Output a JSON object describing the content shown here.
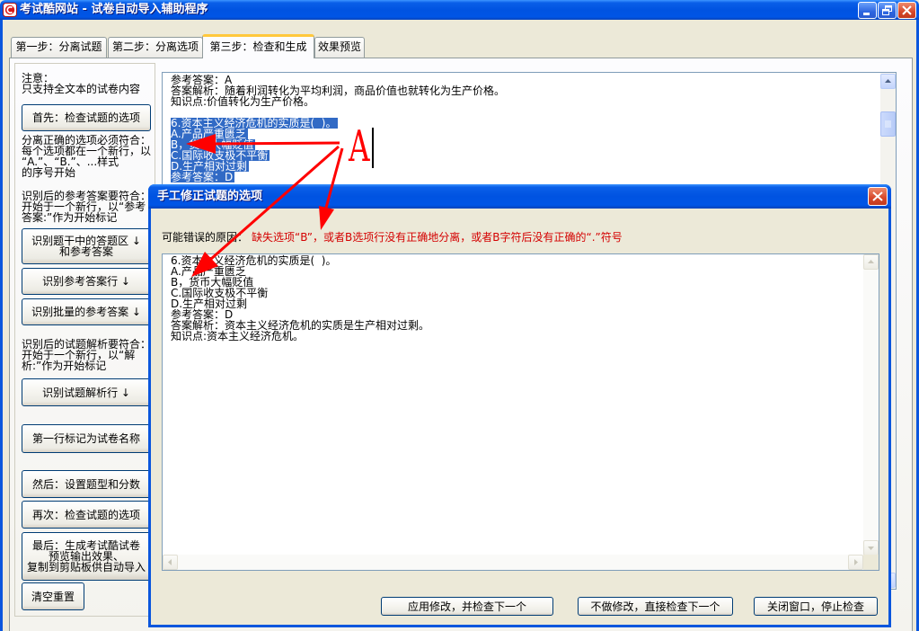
{
  "window": {
    "title": "考试酷网站 - 试卷自动导入辅助程序",
    "icons": {
      "app": "app-logo-icon",
      "minimize": "minimize-icon",
      "restore": "restore-icon",
      "close": "close-icon"
    }
  },
  "tabs": [
    {
      "label": "第一步：分离试题",
      "active": false
    },
    {
      "label": "第二步：分离选项",
      "active": false
    },
    {
      "label": "第三步：检查和生成",
      "active": true
    },
    {
      "label": "效果预览",
      "active": false
    }
  ],
  "sidebar": {
    "note": "注意：\n只支持全文本的试卷内容",
    "check_options_button": "首先：检查试题的选项",
    "option_rule": "分离正确的选项必须符合：\n每个选项都在一个新行，以\n“A.”、“B.”、...样式\n的序号开始",
    "answer_rule": "识别后的参考答案要符合：\n开始于一个新行，以“参考\n答案:”作为开始标记",
    "answer_area_button": "识别题干中的答题区 ↓\n和参考答案",
    "answer_line_button": "识别参考答案行 ↓",
    "batch_answer_button": "识别批量的参考答案 ↓",
    "analysis_rule": "识别后的试题解析要符合：\n开始于一个新行，以“解\n析:”作为开始标记",
    "analysis_line_button": "识别试题解析行 ↓",
    "paper_title_button": "第一行标记为试卷名称",
    "set_types_button": "然后：设置题型和分数",
    "recheck_button": "再次：检查试题的选项",
    "generate_button": "最后：生成考试酷试卷\n预览输出效果、\n复制到剪贴板供自动导入",
    "reset_button": "清空重置"
  },
  "editor": {
    "lines": [
      {
        "text": "参考答案：A",
        "selected": false
      },
      {
        "text": "答案解析：随着利润转化为平均利润，商品价值也就转化为生产价格。",
        "selected": false
      },
      {
        "text": "知识点:价值转化为生产价格。",
        "selected": false
      },
      {
        "text": "",
        "selected": false
      },
      {
        "text": "6.资本主义经济危机的实质是(  )。",
        "selected": true
      },
      {
        "text": "A.产品严重匮乏",
        "selected": true
      },
      {
        "text": "B，货币大幅贬值",
        "selected": true
      },
      {
        "text": "C.国际收支极不平衡",
        "selected": true
      },
      {
        "text": "D.生产相对过剩",
        "selected": true
      },
      {
        "text": "参考答案：D",
        "selected": true
      }
    ]
  },
  "dialog": {
    "title": "手工修正试题的选项",
    "reason_label": "可能错误的原因：",
    "reason_text": "缺失选项“B”，或者B选项行没有正确地分离，或者B字符后没有正确的“.”符号",
    "content": "6.资本主义经济危机的实质是(  )。\nA.产品严重匮乏\nB，货币大幅贬值\nC.国际收支极不平衡\nD.生产相对过剩\n参考答案：D\n答案解析：资本主义经济危机的实质是生产相对过剩。\n知识点:资本主义经济危机。",
    "buttons": {
      "apply": "应用修改，并检查下一个",
      "skip": "不做修改，直接检查下一个",
      "close": "关闭窗口，停止检查"
    }
  },
  "annotation": {
    "letter": "A",
    "arrow_icon": "red-arrow"
  },
  "colors": {
    "selection": "#316AC5",
    "error_text": "#D40000",
    "annotation": "#FF0000",
    "window_body": "#ECE9D8",
    "title_bar": "#0055E6"
  }
}
